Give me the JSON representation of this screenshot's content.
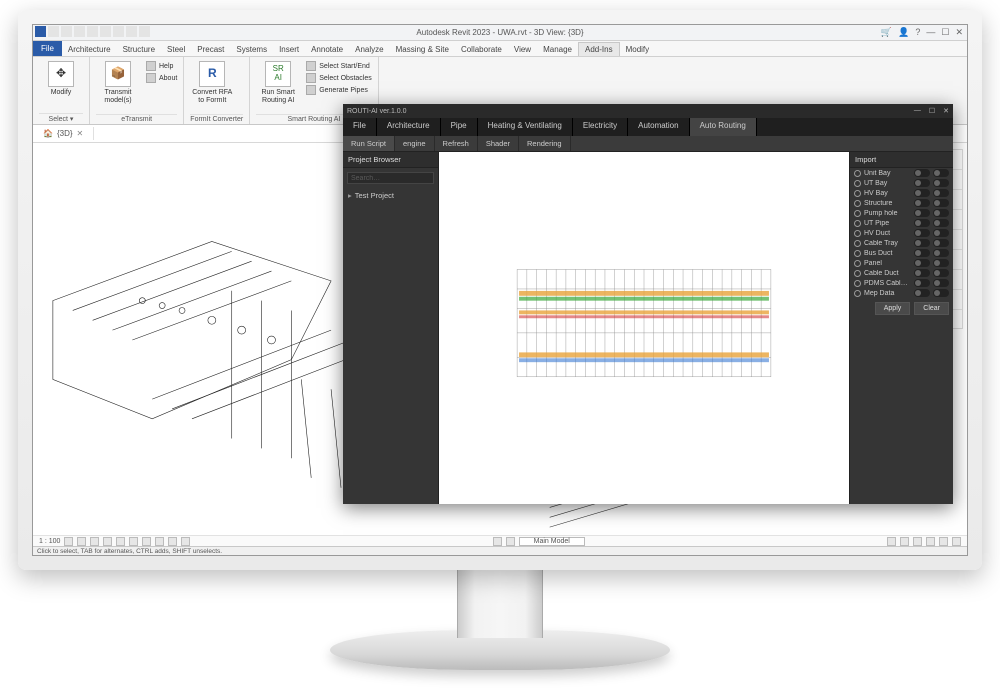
{
  "app": {
    "title": "Autodesk Revit 2023 - UWA.rvt - 3D View: {3D}"
  },
  "ribbonTabs": {
    "file": "File",
    "items": [
      "Architecture",
      "Structure",
      "Steel",
      "Precast",
      "Systems",
      "Insert",
      "Annotate",
      "Analyze",
      "Massing & Site",
      "Collaborate",
      "View",
      "Manage",
      "Add-Ins",
      "Modify"
    ],
    "activeIndex": 12
  },
  "ribbon": {
    "modify": {
      "label": "Modify",
      "select": "Select ▾",
      "group": ""
    },
    "etransmit": {
      "transmit": "Transmit model(s)",
      "help": "Help",
      "about": "About",
      "group": "eTransmit"
    },
    "formit": {
      "convert": "Convert RFA to FormIt",
      "group": "FormIt Converter"
    },
    "smart": {
      "run": "Run Smart Routing AI",
      "a": "Select Start/End",
      "b": "Select Obstacles",
      "c": "Generate Pipes",
      "group": "Smart Routing AI"
    }
  },
  "viewTab": {
    "icon": "🏠",
    "name": "{3D}"
  },
  "viewbar": {
    "scale": "1 : 100"
  },
  "statusbar": {
    "left": "Click to select, TAB for alternates, CTRL adds, SHIFT unselects.",
    "middle": "Main Model"
  },
  "plugin": {
    "title": "ROUTI-AI ver.1.0.0",
    "tabs": [
      "File",
      "Architecture",
      "Pipe",
      "Heating & Ventilating",
      "Electricity",
      "Automation",
      "Auto Routing"
    ],
    "tabActive": 6,
    "subtabs": [
      "Run Script",
      "engine",
      "Refresh",
      "Shader",
      "Rendering"
    ],
    "subActive": 0,
    "projectBrowser": "Project Browser",
    "searchPlaceholder": "Search…",
    "treeItem": "Test Project",
    "importHdr": "Import",
    "importItems": [
      "Unit Bay",
      "UT Bay",
      "HV Bay",
      "Structure",
      "Pump hole",
      "UT Pipe",
      "HV Duct",
      "Cable Tray",
      "Bus Duct",
      "Panel",
      "Cable Duct",
      "PDMS Cable Duct",
      "Mep Data"
    ],
    "apply": "Apply",
    "clear": "Clear"
  }
}
